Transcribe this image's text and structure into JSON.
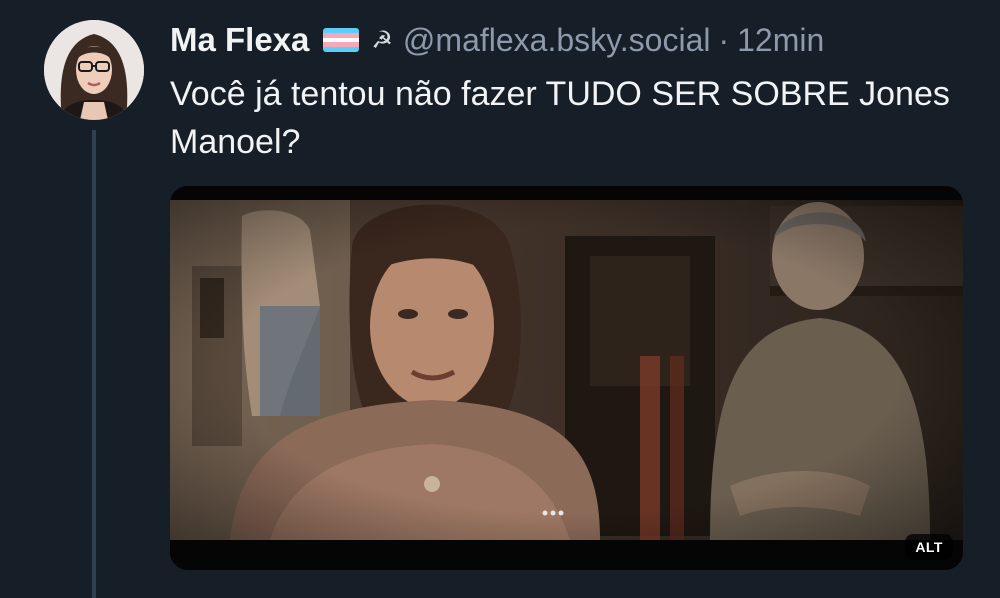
{
  "post": {
    "author": {
      "display_name": "Ma Flexa",
      "handle": "@maflexa.bsky.social",
      "flag_colors": [
        "#5bcefa",
        "#f5a9b8",
        "#ffffff",
        "#f5a9b8",
        "#5bcefa"
      ],
      "symbol": "☭"
    },
    "separator": "·",
    "timestamp": "12min",
    "text": "Você já tentou não fazer TUDO SER SOBRE Jones Manoel?",
    "media": {
      "alt_badge": "ALT"
    }
  },
  "colors": {
    "background": "#161e27",
    "primary_text": "#f1f3f5",
    "secondary_text": "#8c9aab",
    "thread_line": "#2e4153"
  }
}
